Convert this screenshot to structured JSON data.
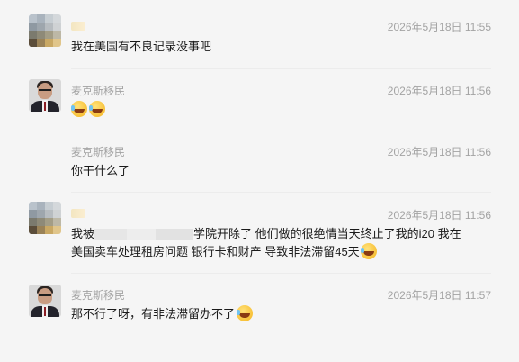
{
  "messages": [
    {
      "sender": "",
      "time": "2026年5月18日 11:55",
      "text": "我在美国有不良记录没事吧"
    },
    {
      "sender": "麦克斯移民",
      "time": "2026年5月18日 11:56",
      "emojis": [
        "laugh-cry-emoji",
        "laugh-cry-emoji"
      ]
    },
    {
      "sender": "麦克斯移民",
      "time": "2026年5月18日 11:56",
      "text": "你干什么了"
    },
    {
      "sender": "",
      "time": "2026年5月18日 11:56",
      "line1_pre": "我被",
      "line1_post": "学院开除了 他们做的很绝情当天终止了我的i20 我在",
      "line2": "美国卖车处理租房问题 银行卡和财产 导致非法滞留45天"
    },
    {
      "sender": "麦克斯移民",
      "time": "2026年5月18日 11:57",
      "text": "那不行了呀，有非法滞留办不了"
    }
  ]
}
